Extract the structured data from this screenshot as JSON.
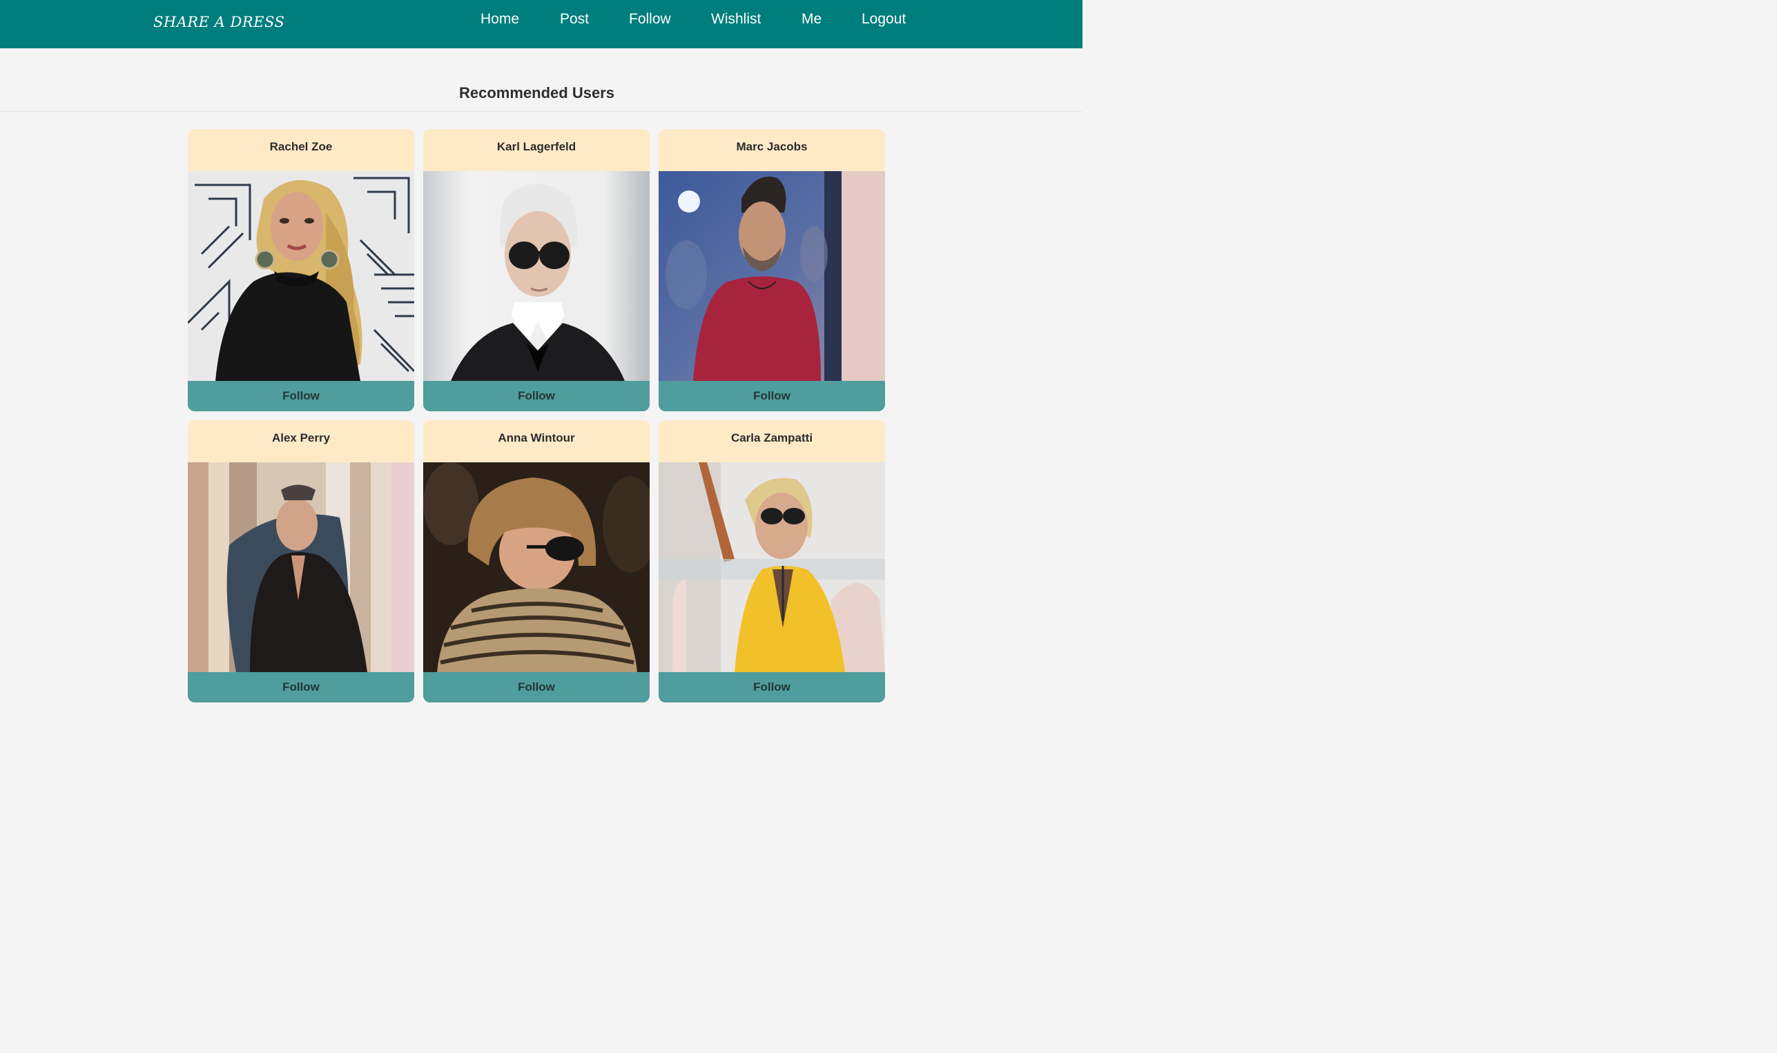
{
  "brand": {
    "title": "SHARE A DRESS"
  },
  "nav": {
    "items": [
      {
        "label": "Home"
      },
      {
        "label": "Post"
      },
      {
        "label": "Follow"
      },
      {
        "label": "Wishlist"
      },
      {
        "label": "Me"
      },
      {
        "label": "Logout"
      }
    ]
  },
  "main": {
    "title": "Recommended Users",
    "follow_label": "Follow",
    "users": [
      {
        "name": "Rachel Zoe"
      },
      {
        "name": "Karl Lagerfeld"
      },
      {
        "name": "Marc Jacobs"
      },
      {
        "name": "Alex Perry"
      },
      {
        "name": "Anna Wintour"
      },
      {
        "name": "Carla Zampatti"
      }
    ]
  },
  "colors": {
    "navbar": "#007d7d",
    "card_header": "#ffeac8",
    "follow_button": "#4f9d9d",
    "page_background": "#f4f4f4"
  }
}
